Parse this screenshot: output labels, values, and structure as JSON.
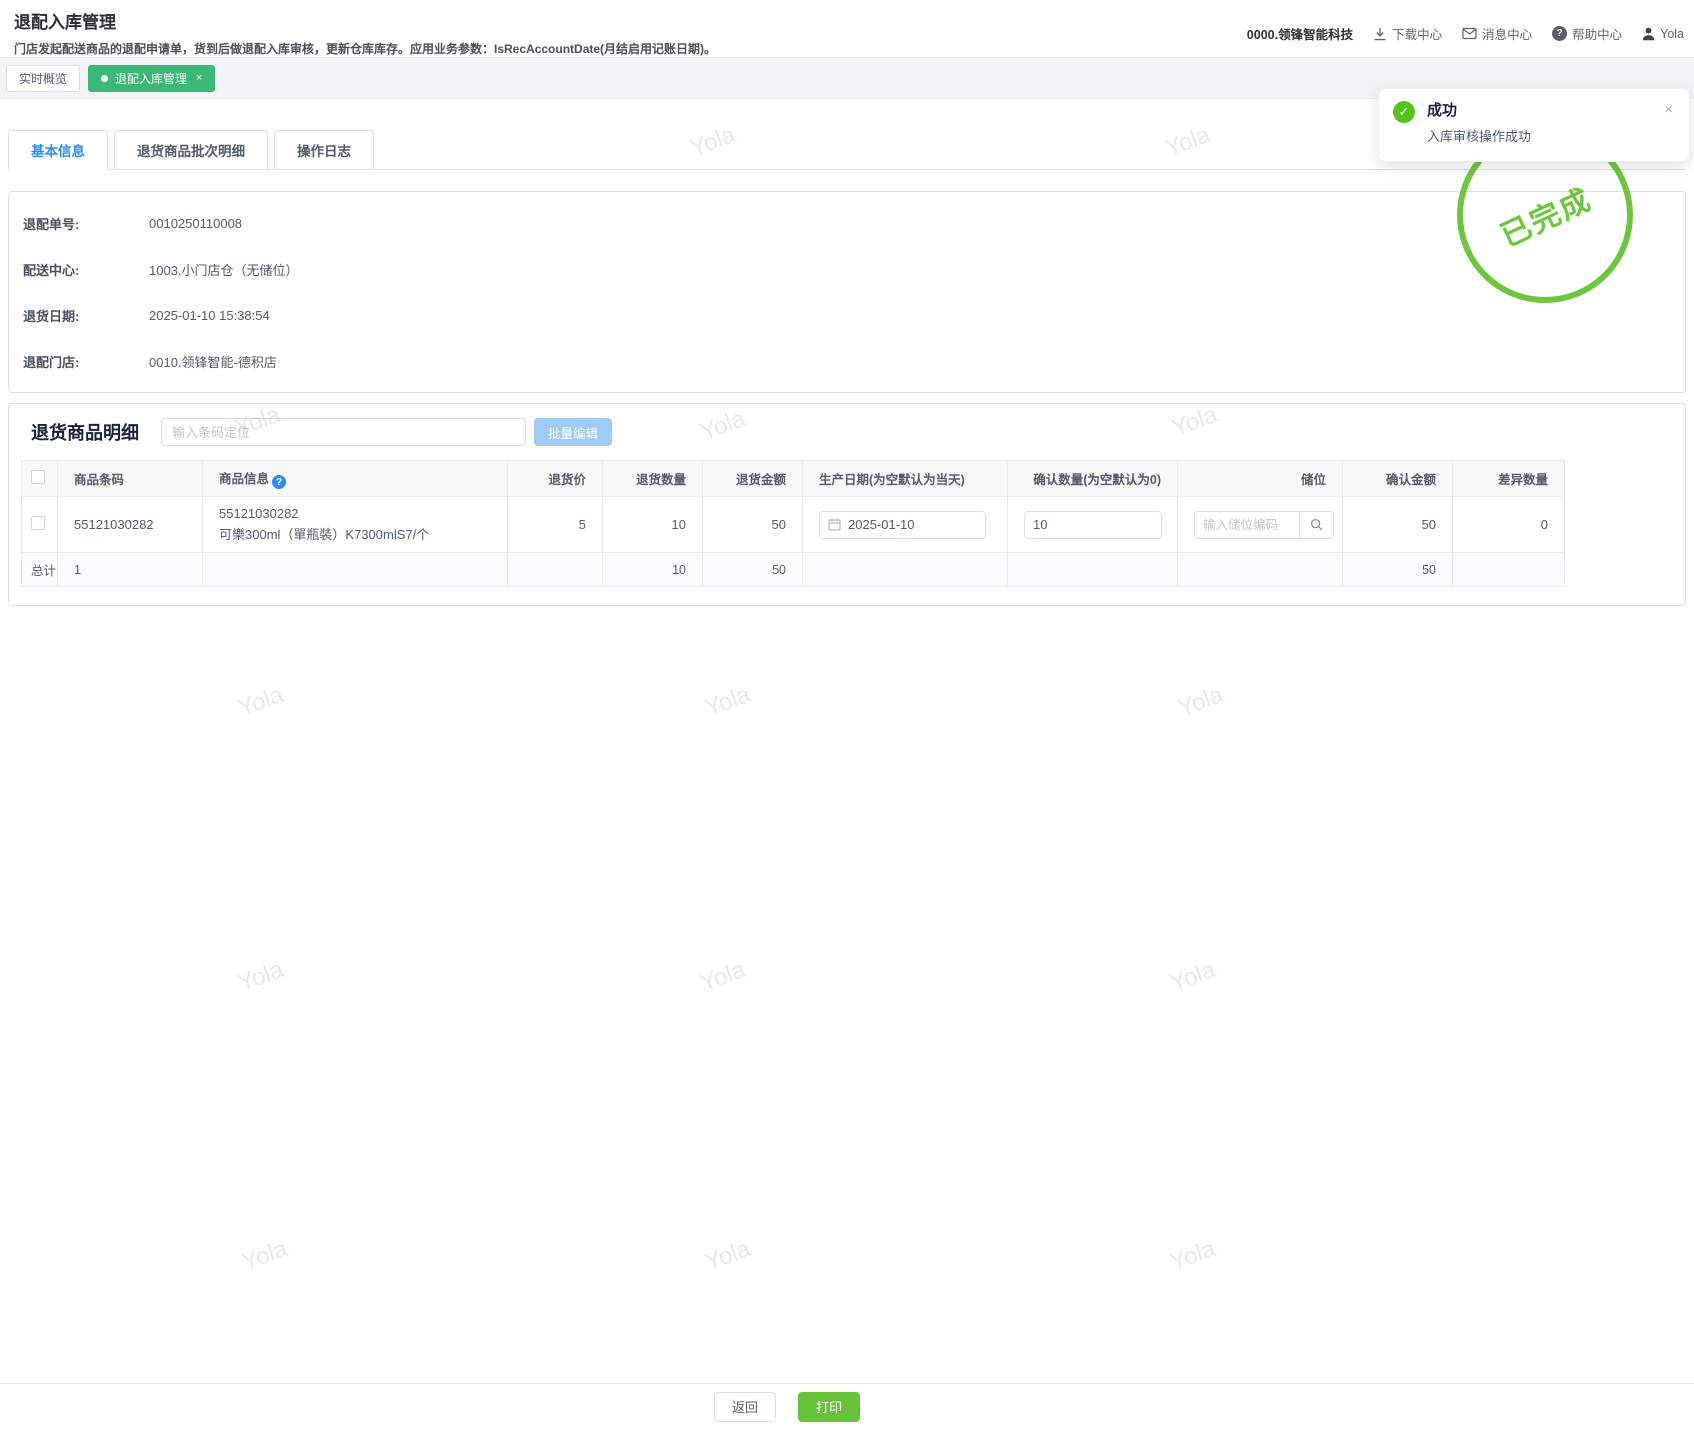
{
  "page": {
    "title": "退配入库管理",
    "subtitle": "门店发起配送商品的退配申请单，货到后做退配入库审核，更新仓库库存。应用业务参数：IsRecAccountDate(月结启用记账日期)。"
  },
  "topbar": {
    "company": "0000.领锋智能科技",
    "download": "下载中心",
    "message": "消息中心",
    "help": "帮助中心",
    "user": "Yola"
  },
  "nav_tabs": {
    "overview": "实时概览",
    "current": "退配入库管理",
    "close": "×"
  },
  "toast": {
    "title": "成功",
    "message": "入库审核操作成功",
    "check": "✓",
    "close": "×"
  },
  "stamp": {
    "label": "已完成"
  },
  "detail_tabs": [
    {
      "label": "基本信息"
    },
    {
      "label": "退货商品批次明细"
    },
    {
      "label": "操作日志"
    }
  ],
  "info": {
    "fields": [
      {
        "label": "退配单号:",
        "value": "0010250110008"
      },
      {
        "label": "配送中心:",
        "value": "1003.小门店仓（无储位）"
      },
      {
        "label": "退货日期:",
        "value": "2025-01-10 15:38:54"
      },
      {
        "label": "退配门店:",
        "value": "0010.领锋智能-德积店"
      }
    ]
  },
  "section": {
    "title": "退货商品明细",
    "search_placeholder": "输入条码定位",
    "batch_edit": "批量编辑"
  },
  "table": {
    "headers": [
      "商品条码",
      "商品信息",
      "退货价",
      "退货数量",
      "退货金额",
      "生产日期(为空默认为当天)",
      "确认数量(为空默认为0)",
      "储位",
      "确认金额",
      "差异数量"
    ],
    "help_mark": "?",
    "row": {
      "barcode": "55121030282",
      "product_line1": "55121030282",
      "product_line2": "可樂300ml（單瓶裝）K7300mlS7/个",
      "price": "5",
      "qty": "10",
      "amount": "50",
      "production_date": "2025-01-10",
      "confirm_qty": "10",
      "storage_placeholder": "输入储位编码",
      "confirm_amount": "50",
      "diff_qty": "0"
    },
    "total": {
      "label": "总计",
      "count": "1",
      "qty": "10",
      "amount": "50",
      "confirm_amount": "50"
    }
  },
  "footer": {
    "back": "返回",
    "print": "打印"
  },
  "watermark": {
    "text": "Yola"
  },
  "colors": {
    "nav_tab_green": "#3cb876",
    "stamp_green": "#6ec63e",
    "print_green": "#67c23a",
    "toast_green": "#52c41a",
    "link_blue": "#2d8cf0",
    "batch_btn_blue": "#9fccf7"
  }
}
